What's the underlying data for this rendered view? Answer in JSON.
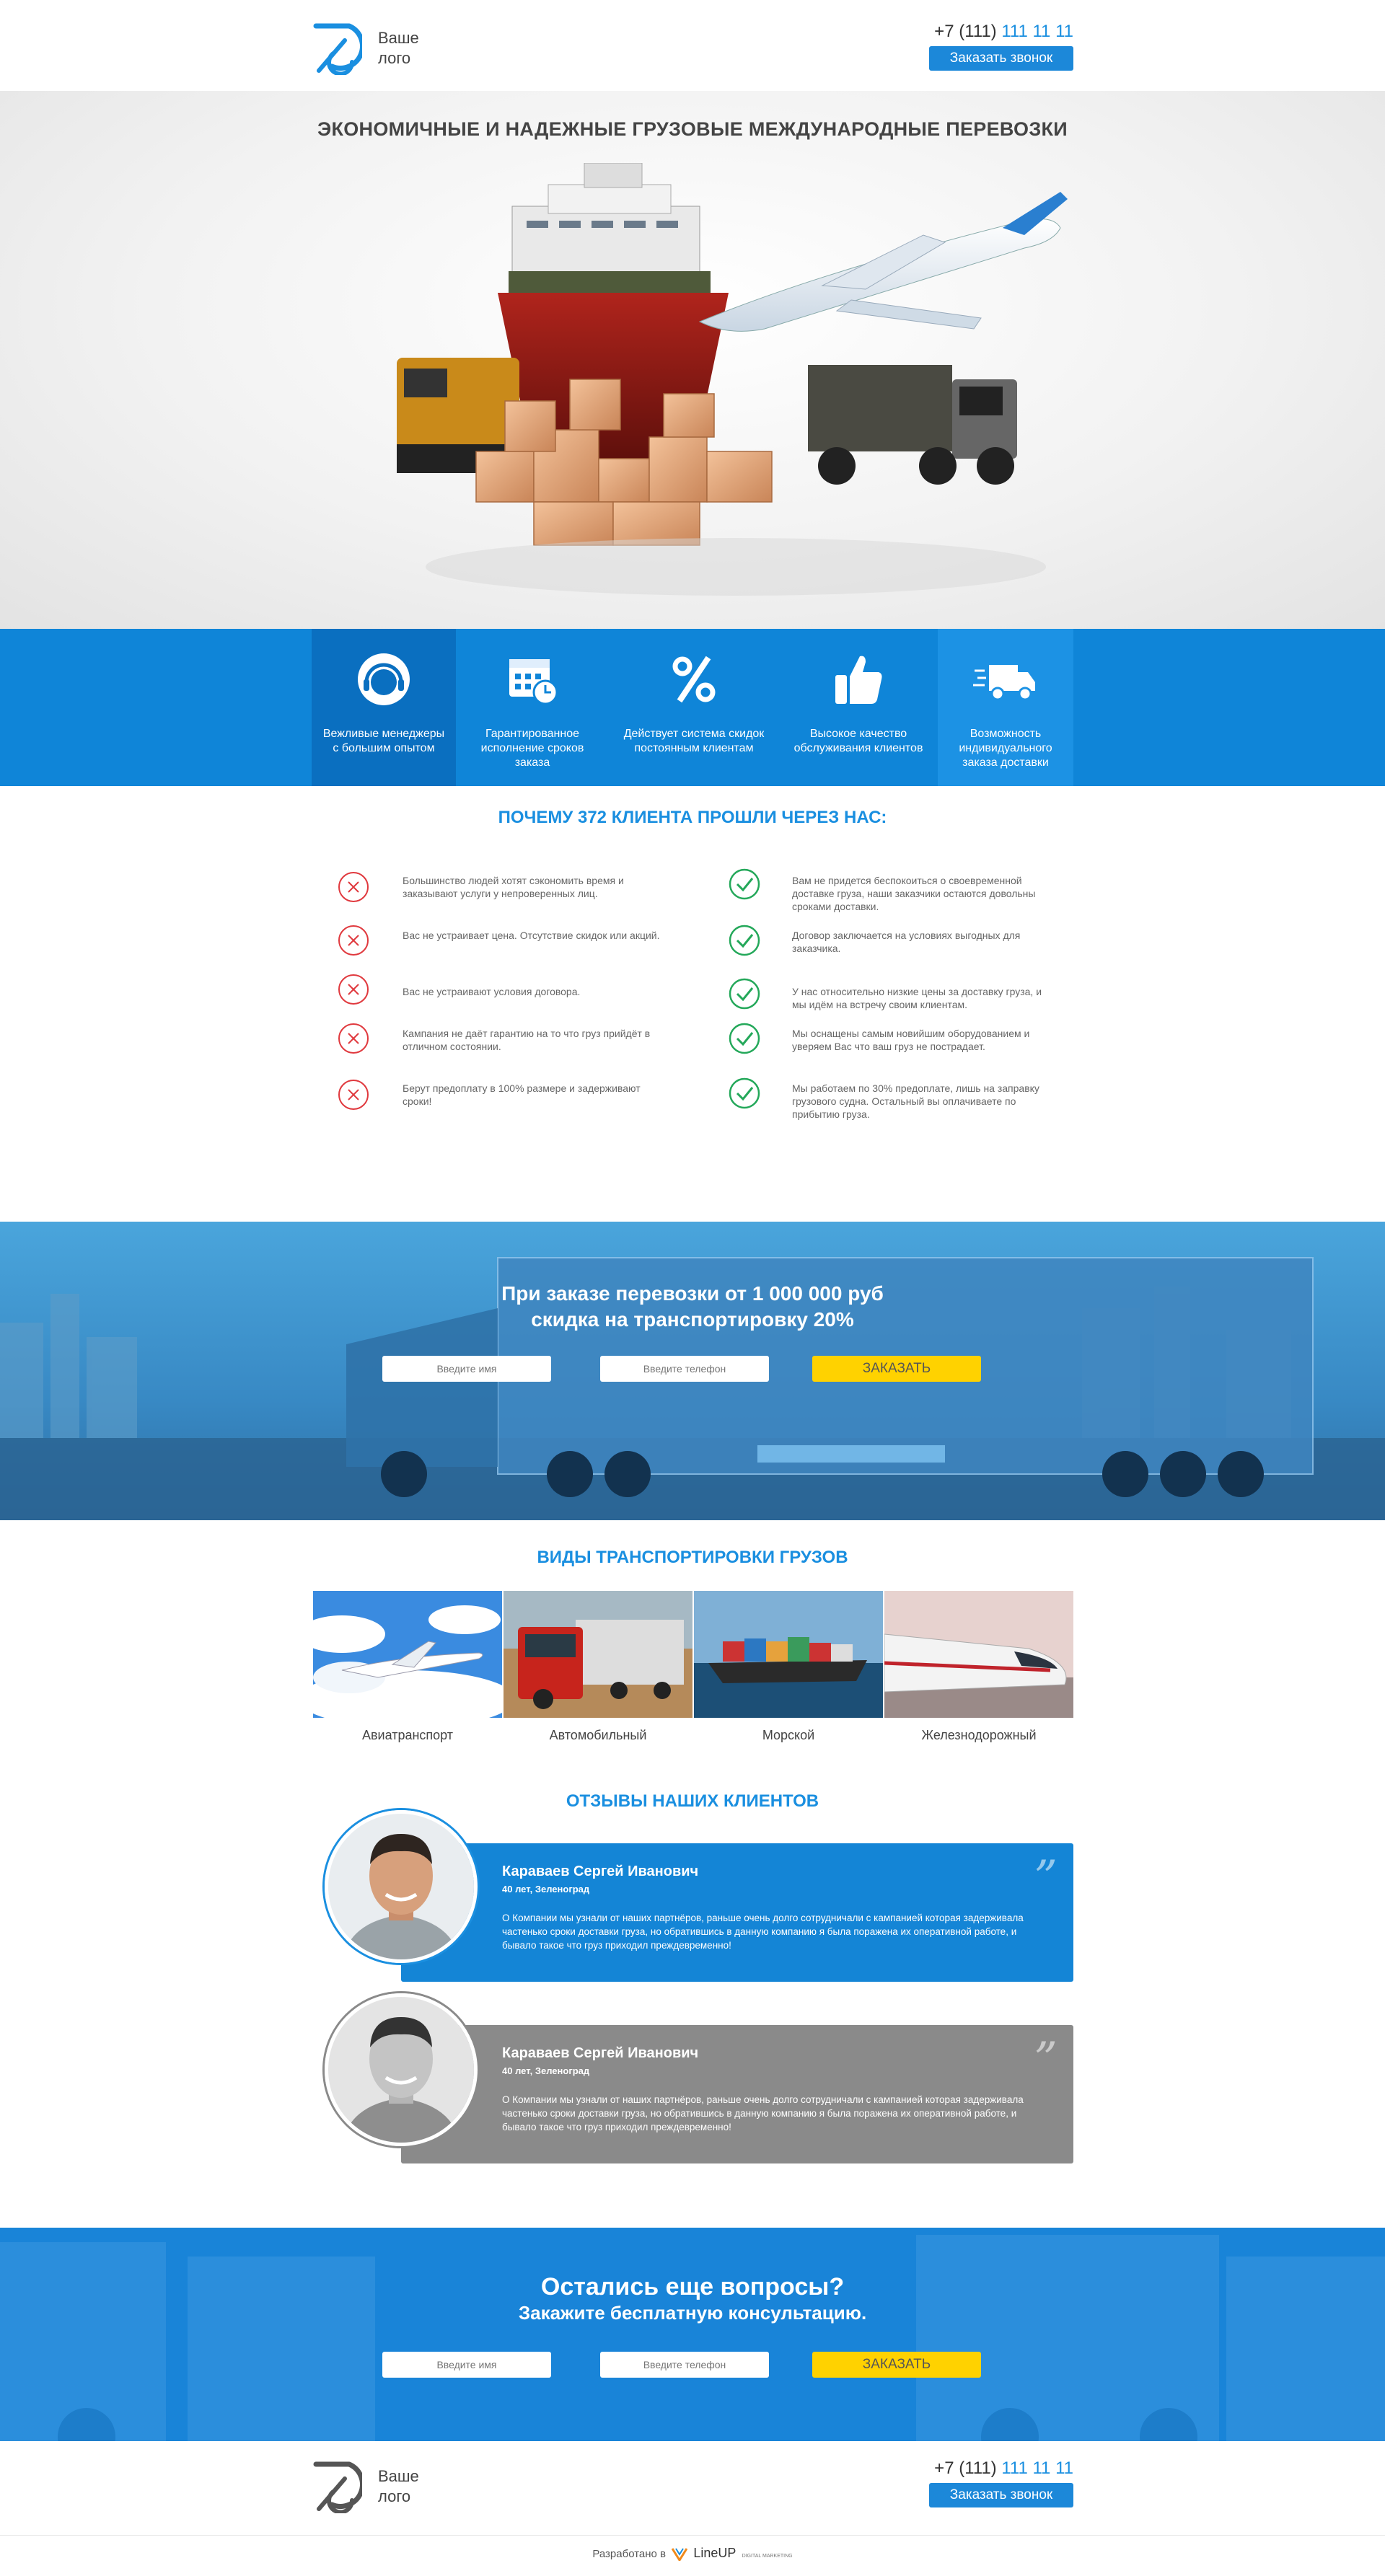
{
  "header": {
    "logo_line1": "Ваше",
    "logo_line2": "лого",
    "phone_prefix": "+7 (111)",
    "phone_number": "111 11 11",
    "call_button": "Заказать звонок"
  },
  "hero": {
    "title": "ЭКОНОМИЧНЫЕ И НАДЕЖНЫЕ ГРУЗОВЫЕ МЕЖДУНАРОДНЫЕ ПЕРЕВОЗКИ"
  },
  "features": [
    {
      "label": "Вежливые менеджеры с большим опытом",
      "icon": "headset-icon"
    },
    {
      "label": "Гарантированное исполнение сроков заказа",
      "icon": "calendar-clock-icon"
    },
    {
      "label": "Действует система скидок постоянным клиентам",
      "icon": "percent-icon"
    },
    {
      "label": "Высокое качество обслуживания клиентов",
      "icon": "thumbs-up-icon"
    },
    {
      "label": "Возможность индивидуального заказа доставки",
      "icon": "delivery-truck-icon"
    }
  ],
  "why": {
    "title": "ПОЧЕМУ 372 КЛИЕНТА ПРОШЛИ ЧЕРЕЗ НАС:",
    "cons": [
      "Большинство людей хотят сэкономить время и заказывают услуги у непроверенных лиц.",
      "Вас не устраивает цена. Отсутствие скидок или акций.",
      "Вас не устраивают условия договора.",
      "Кампания не даёт гарантию на то что груз прийдёт в отличном состоянии.",
      "Берут предоплату в 100% размере и задерживают сроки!"
    ],
    "pros": [
      "Вам не придется беспокоиться о своевременной доставке груза, наши заказчики остаются довольны сроками доставки.",
      "Договор заключается на условиях выгодных для заказчика.",
      "У нас относительно низкие цены за доставку груза, и мы идём на встречу своим клиентам.",
      "Мы оснащены самым новийшим оборудованием и уверяем Вас что ваш груз не пострадает.",
      "Мы работаем по 30% предоплате, лишь на заправку грузового судна. Остальный вы оплачиваете по прибытию груза."
    ]
  },
  "promo": {
    "line1": "При заказе перевозки от 1 000 000 руб",
    "line2": "скидка на транспортировку 20%",
    "name_placeholder": "Введите имя",
    "phone_placeholder": "Введите телефон",
    "submit": "ЗАКАЗАТЬ"
  },
  "transport": {
    "title": "ВИДЫ ТРАНСПОРТИРОВКИ ГРУЗОВ",
    "items": [
      "Авиатранспорт",
      "Автомобильный",
      "Морской",
      "Железнодорожный"
    ]
  },
  "reviews": {
    "title": "ОТЗЫВЫ НАШИХ КЛИЕНТОВ",
    "items": [
      {
        "name": "Караваев Сергей Иванович",
        "meta": "40 лет, Зеленоград",
        "text": "О Компании мы узнали от наших партнёров, раньше очень долго сотрудничали с кампанией которая задерживала частенько сроки доставки груза, но обратившись в данную компанию я была поражена их оперативной работе, и бывало такое что груз приходил преждевременно!",
        "color": "#1485d6"
      },
      {
        "name": "Караваев Сергей Иванович",
        "meta": "40 лет, Зеленоград",
        "text": "О Компании мы узнали от наших партнёров, раньше очень долго сотрудничали с кампанией которая задерживала частенько сроки доставки груза, но обратившись в данную компанию я была поражена их оперативной работе, и бывало такое что груз приходил преждевременно!",
        "color": "#8a8a8a"
      }
    ]
  },
  "consult": {
    "title": "Остались еще вопросы?",
    "subtitle": "Закажите бесплатную консультацию.",
    "name_placeholder": "Введите имя",
    "phone_placeholder": "Введите телефон",
    "submit": "ЗАКАЗАТЬ"
  },
  "footer": {
    "logo_line1": "Ваше",
    "logo_line2": "лого",
    "phone_prefix": "+7 (111)",
    "phone_number": "111 11 11",
    "call_button": "Заказать звонок",
    "dev_text": "Разработано в",
    "dev_brand": "LineUP",
    "dev_brand_sub": "DIGITAL MARKETING"
  },
  "colors": {
    "accent": "#1a8fe0",
    "features_bg": "#0f85d8",
    "button_yellow": "#ffd200"
  }
}
